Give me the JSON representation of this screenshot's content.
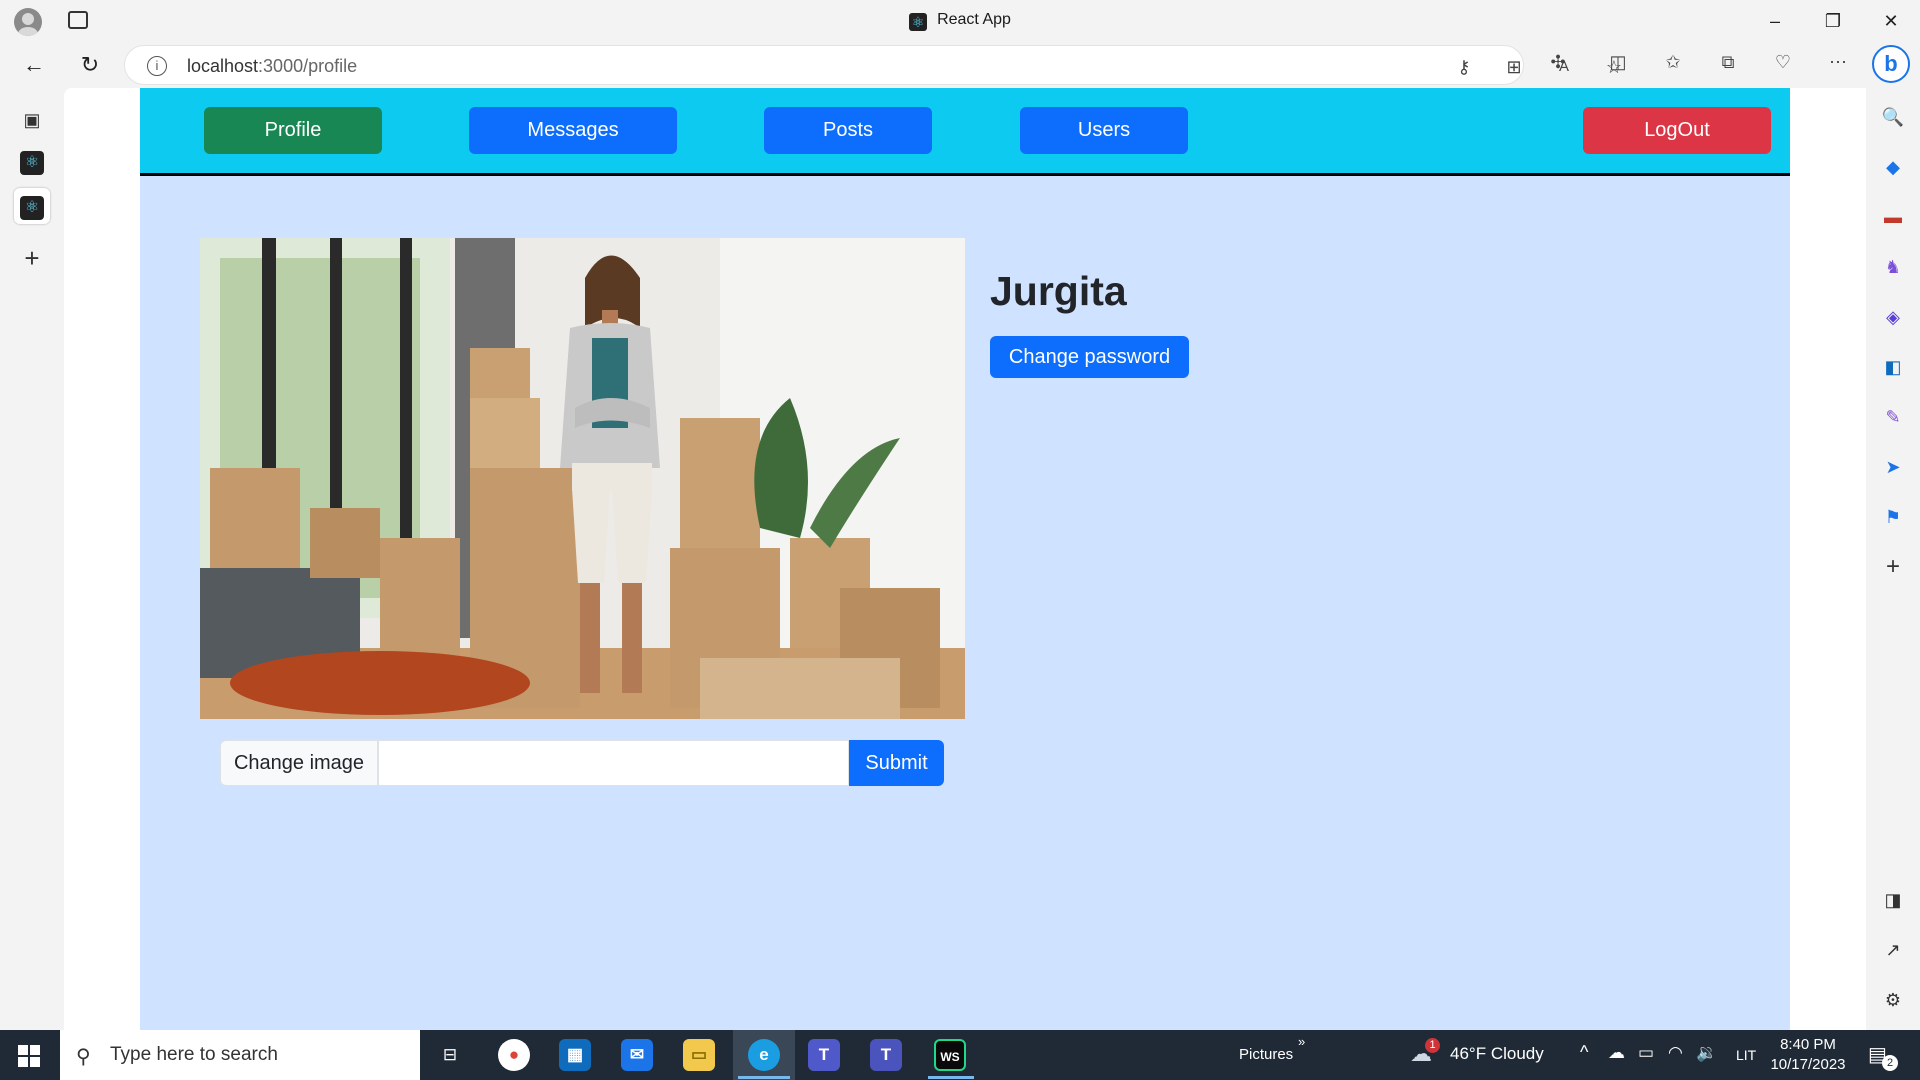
{
  "browser": {
    "window_title": "React App",
    "url_host": "localhost",
    "url_rest": ":3000/profile"
  },
  "nav": {
    "profile": "Profile",
    "messages": "Messages",
    "posts": "Posts",
    "users": "Users",
    "logout": "LogOut"
  },
  "profile": {
    "name": "Jurgita",
    "change_password": "Change password",
    "change_image": "Change image",
    "submit": "Submit",
    "file_value": ""
  },
  "taskbar": {
    "search_placeholder": "Type here to search",
    "pictures": "Pictures",
    "weather": "46°F  Cloudy",
    "weather_badge": "1",
    "lang": "LIT",
    "time": "8:40 PM",
    "date": "10/17/2023",
    "notif_count": "2"
  },
  "colors": {
    "navbar": "#0dcaf0",
    "page_bg": "#cfe2ff",
    "primary": "#0d6efd",
    "success": "#198754",
    "danger": "#dc3545"
  }
}
